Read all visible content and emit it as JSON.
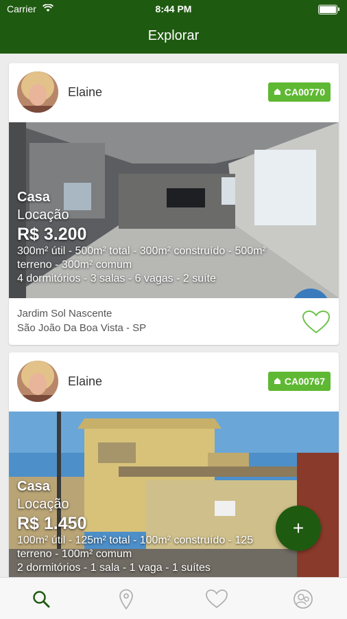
{
  "status_bar": {
    "carrier": "Carrier",
    "time": "8:44 PM",
    "wifi_icon": "wifi-icon",
    "battery_icon": "battery-icon"
  },
  "nav": {
    "title": "Explorar"
  },
  "colors": {
    "primary": "#1f5a11",
    "badge": "#5fb833",
    "heart": "#6cc24a"
  },
  "listings": [
    {
      "agent": "Elaine",
      "code": "CA00770",
      "type": "Casa",
      "deal": "Locação",
      "price": "R$ 3.200",
      "details_line1": "300m² útil - 500m² total - 300m² construído - 500m²",
      "details_line2": "terreno - 300m² comum",
      "details_line3": "4 dormitórios - 3 salas - 6 vagas - 2 suíte",
      "neighborhood": "Jardim Sol Nascente",
      "city": "São João Da Boa Vista - SP"
    },
    {
      "agent": "Elaine",
      "code": "CA00767",
      "type": "Casa",
      "deal": "Locação",
      "price": "R$ 1.450",
      "details_line1": "100m² útil - 125m² total - 100m² construído - 125",
      "details_line2": "terreno - 100m² comum",
      "details_line3": "2 dormitórios - 1 sala - 1 vaga - 1 suítes"
    }
  ],
  "fab": {
    "label": "+"
  },
  "tabs": [
    "search-icon",
    "location-pin-icon",
    "heart-icon",
    "profile-icon"
  ]
}
